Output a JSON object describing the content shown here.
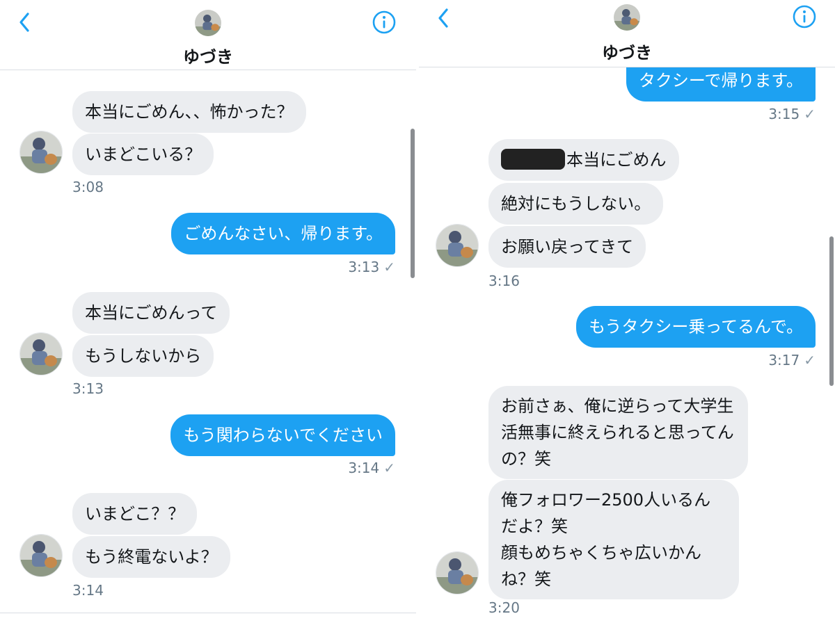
{
  "colors": {
    "accent": "#1da1f2",
    "incoming_bubble": "#ebedf0",
    "time_text": "#657786"
  },
  "icons": {
    "back": "chevron-left-icon",
    "info": "info-circle-icon",
    "read": "checkmark-icon"
  },
  "left": {
    "header": {
      "name": "ゆづき"
    },
    "messages": [
      {
        "text": "本当にごめん、、怖かった？"
      },
      {
        "text": "いまどこいる？"
      },
      {
        "time": "3:08"
      },
      {
        "text": "ごめんなさい、帰ります。"
      },
      {
        "time": "3:13",
        "check": "✓"
      },
      {
        "text": "本当にごめんって"
      },
      {
        "text": "もうしないから"
      },
      {
        "time": "3:13"
      },
      {
        "text": "もう関わらないでください"
      },
      {
        "time": "3:14",
        "check": "✓"
      },
      {
        "text": "いまどこ？？"
      },
      {
        "text": "もう終電ないよ？"
      },
      {
        "time": "3:14"
      }
    ]
  },
  "right": {
    "header": {
      "name": "ゆづき"
    },
    "messages": [
      {
        "text": "タクシーで帰ります。"
      },
      {
        "time": "3:15",
        "check": "✓"
      },
      {
        "text": "本当にごめん"
      },
      {
        "text": "絶対にもうしない。"
      },
      {
        "text": "お願い戻ってきて"
      },
      {
        "time": "3:16"
      },
      {
        "text": "もうタクシー乗ってるんで。"
      },
      {
        "time": "3:17",
        "check": "✓"
      },
      {
        "text": "お前さぁ、俺に逆らって大学生活無事に終えられると思ってんの？笑"
      },
      {
        "text": "俺フォロワー2500人いるんだよ？笑\n顔もめちゃくちゃ広いかんね？笑"
      },
      {
        "time": "3:20"
      }
    ]
  }
}
